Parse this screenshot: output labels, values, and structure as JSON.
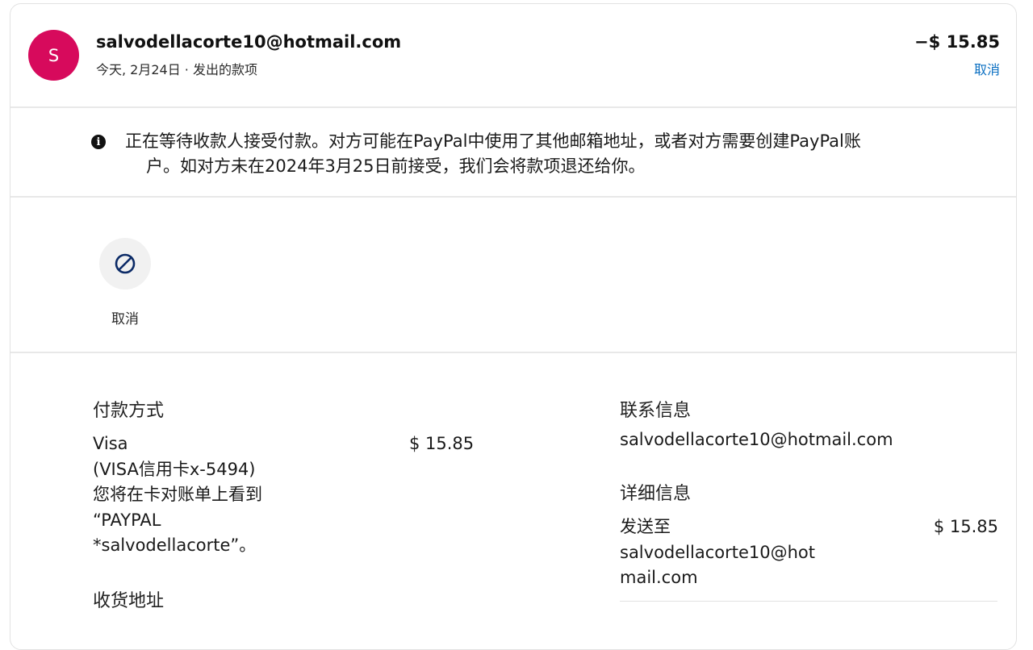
{
  "header": {
    "avatar_letter": "S",
    "recipient": "salvodellacorte10@hotmail.com",
    "subtitle": "今天, 2月24日 · 发出的款项",
    "amount": "−$ 15.85",
    "cancel_label": "取消"
  },
  "notice": {
    "icon": "info-icon",
    "line1": "正在等待收款人接受付款。对方可能在PayPal中使用了其他邮箱地址，或者对方需要创建PayPal账",
    "line2": "户。如对方未在2024年3月25日前接受，我们会将款项退还给你。"
  },
  "actions": {
    "cancel_icon": "cancel-circle-icon",
    "cancel_label": "取消"
  },
  "payment": {
    "heading": "付款方式",
    "method": "Visa",
    "card": "(VISA信用卡x-5494)",
    "statement_line1": "您将在卡对账单上看到",
    "statement_line2": "“PAYPAL",
    "statement_line3": "*salvodellacorte”。",
    "amount": "$ 15.85"
  },
  "shipping": {
    "heading": "收货地址"
  },
  "contact": {
    "heading": "联系信息",
    "email": "salvodellacorte10@hotmail.com"
  },
  "details": {
    "heading": "详细信息",
    "sent_to_label": "发送至",
    "sent_to_email_line1": "salvodellacorte10@hot",
    "sent_to_email_line2": "mail.com",
    "amount": "$ 15.85"
  },
  "colors": {
    "avatar": "#d70a5c",
    "link": "#0a6fc2",
    "cancel_icon": "#0b2a66"
  }
}
